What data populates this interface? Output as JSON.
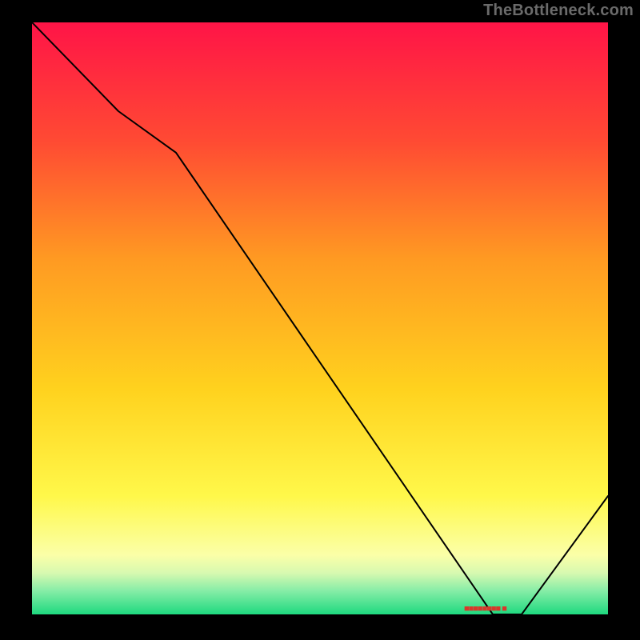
{
  "attribution": "TheBottleneck.com",
  "chart_data": {
    "type": "line",
    "title": "",
    "xlabel": "",
    "ylabel": "",
    "x": [
      0,
      15,
      25,
      80,
      85,
      100
    ],
    "values": [
      100,
      85,
      78,
      0,
      0,
      20
    ],
    "xlim": [
      0,
      100
    ],
    "ylim": [
      0,
      100
    ],
    "min_region": {
      "x_start": 75,
      "x_end": 90,
      "y": 0,
      "label": "■■■■■■■■ ■"
    },
    "background": {
      "type": "vertical-gradient",
      "stops": [
        {
          "pct": 0,
          "color": "#ff1447"
        },
        {
          "pct": 20,
          "color": "#ff4a33"
        },
        {
          "pct": 40,
          "color": "#ff9a22"
        },
        {
          "pct": 62,
          "color": "#ffd21e"
        },
        {
          "pct": 80,
          "color": "#fff84a"
        },
        {
          "pct": 90,
          "color": "#fbffa8"
        },
        {
          "pct": 93,
          "color": "#d7f9b0"
        },
        {
          "pct": 96,
          "color": "#86eda7"
        },
        {
          "pct": 100,
          "color": "#1ed97f"
        }
      ]
    }
  }
}
